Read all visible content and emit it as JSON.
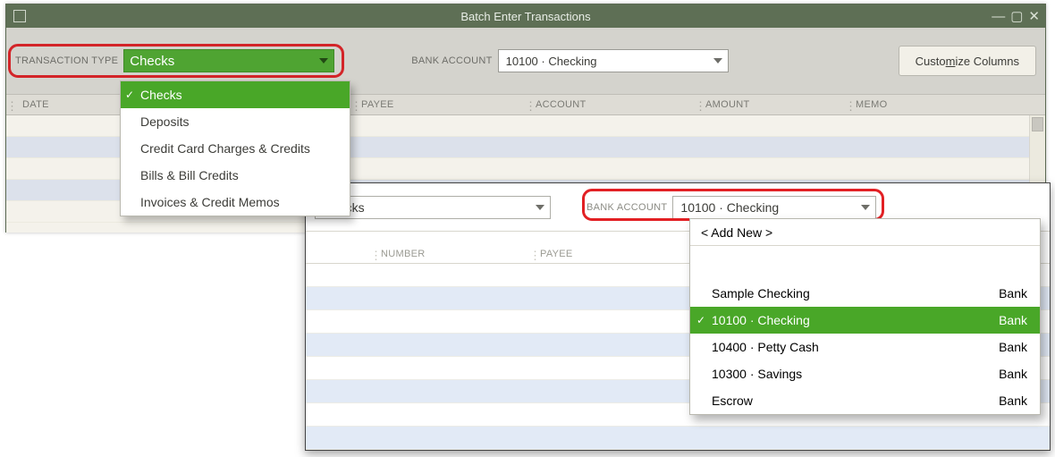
{
  "window": {
    "title": "Batch Enter Transactions"
  },
  "toolbar": {
    "transaction_type_label": "TRANSACTION TYPE",
    "transaction_type_value": "Checks",
    "bank_account_label": "BANK ACCOUNT",
    "bank_account_value": "10100 · Checking",
    "customize_button_prefix": "Custo",
    "customize_button_uline": "m",
    "customize_button_suffix": "ize Columns"
  },
  "columns": {
    "date": "DATE",
    "number": "NUMBER",
    "payee": "PAYEE",
    "account": "ACCOUNT",
    "amount": "AMOUNT",
    "memo": "MEMO"
  },
  "tx_type_menu": {
    "items": [
      "Checks",
      "Deposits",
      "Credit Card Charges & Credits",
      "Bills & Bill Credits",
      "Invoices & Credit Memos"
    ],
    "selected_index": 0
  },
  "front": {
    "tx_combo_value": "Checks",
    "bank_label": "BANK ACCOUNT",
    "bank_value": "10100 · Checking"
  },
  "account_list": {
    "add_new_label": "< Add New >",
    "items": [
      {
        "name": "Sample Checking",
        "type": "Bank"
      },
      {
        "name": "10100 · Checking",
        "type": "Bank"
      },
      {
        "name": "10400 · Petty Cash",
        "type": "Bank"
      },
      {
        "name": "10300 · Savings",
        "type": "Bank"
      },
      {
        "name": "Escrow",
        "type": "Bank"
      }
    ],
    "selected_index": 1
  }
}
